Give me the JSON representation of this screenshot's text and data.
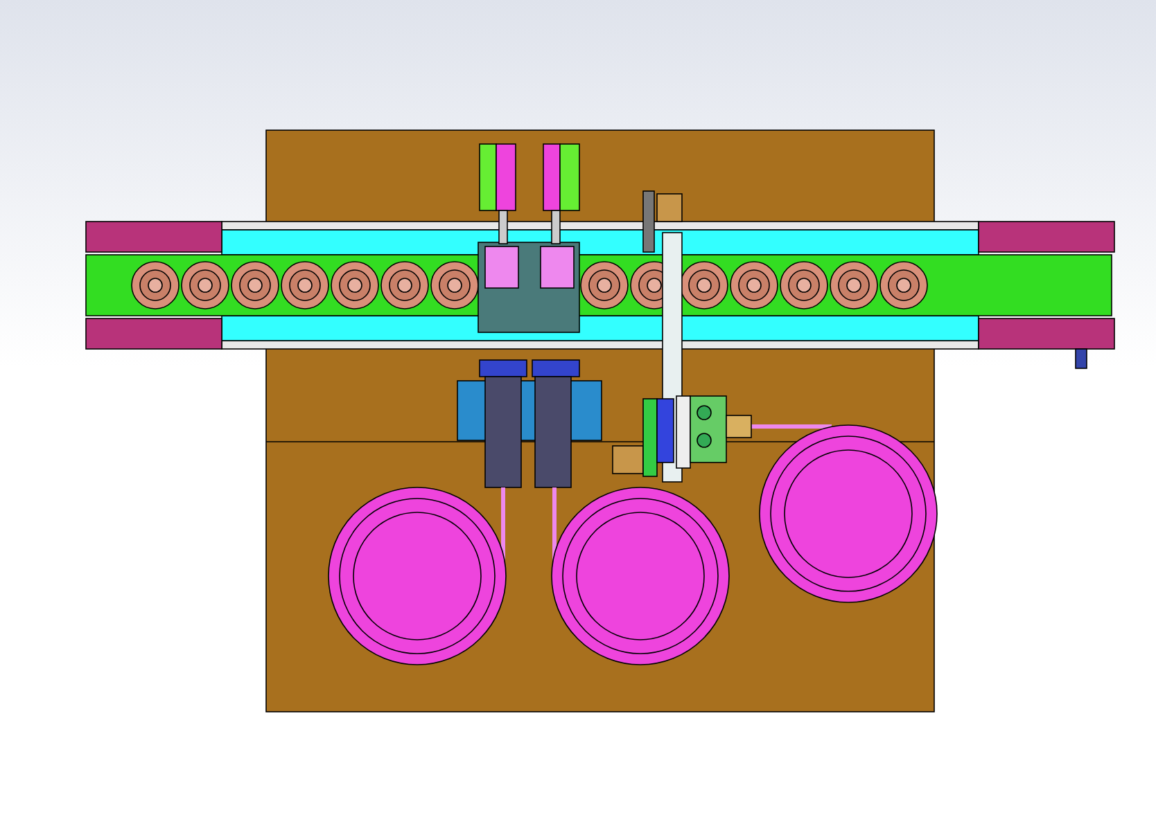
{
  "viewport": {
    "kind": "cad-assembly"
  }
}
